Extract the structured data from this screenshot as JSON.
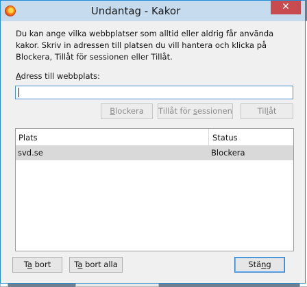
{
  "window": {
    "title": "Undantag - Kakor",
    "close_label": "✕"
  },
  "intro_text": "Du kan ange vilka webbplatser som alltid eller aldrig får använda kakor. Skriv in adressen till platsen du vill hantera och klicka på Blockera, Tillåt för sessionen eller Tillåt.",
  "address": {
    "label": "Adress till webbplats:",
    "value": ""
  },
  "action_buttons": {
    "block": "Blockera",
    "allow_session": "Tillåt för sessionen",
    "allow": "Tillåt"
  },
  "table": {
    "columns": [
      "Plats",
      "Status"
    ],
    "rows": [
      {
        "site": "svd.se",
        "status": "Blockera"
      }
    ]
  },
  "footer_buttons": {
    "remove": "Ta bort",
    "remove_all": "Ta bort alla",
    "close": "Stäng"
  }
}
